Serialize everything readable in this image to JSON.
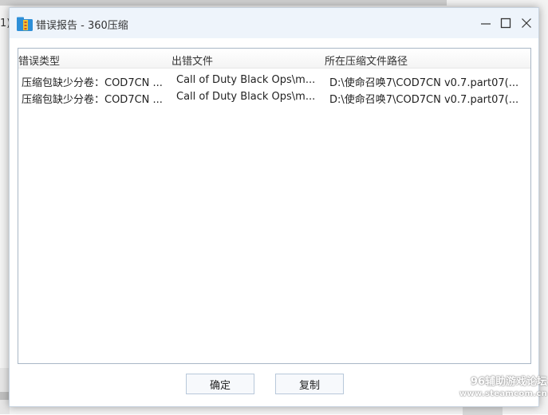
{
  "background": {
    "fragment_text": "1)"
  },
  "dialog": {
    "title": "错误报告 - 360压缩",
    "icons": {
      "app": "archive-app-icon",
      "minimize": "minimize-icon",
      "maximize": "maximize-icon",
      "close": "close-icon"
    }
  },
  "list": {
    "columns": [
      "错误类型",
      "出错文件",
      "所在压缩文件路径"
    ],
    "rows": [
      [
        "压缩包缺少分卷：COD7CN ...",
        "Call of Duty Black Ops\\m...",
        "D:\\使命召唤7\\COD7CN v0.7.part07(..."
      ],
      [
        "压缩包缺少分卷：COD7CN ...",
        "Call of Duty Black Ops\\m...",
        "D:\\使命召唤7\\COD7CN v0.7.part07(..."
      ]
    ]
  },
  "buttons": {
    "ok": "确定",
    "copy": "复制"
  },
  "watermark": {
    "line1": "96辅助游戏论坛",
    "line2": "www.steamcom.cn"
  },
  "colors": {
    "titlebar": "#eef4fb",
    "border": "#a9b7c6",
    "button_border": "#b8c8da"
  }
}
